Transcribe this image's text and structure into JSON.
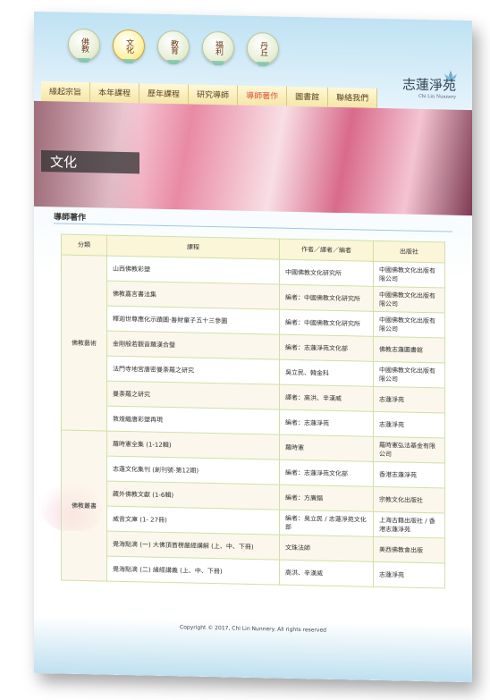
{
  "top_nav": [
    {
      "label": "佛教",
      "active": false
    },
    {
      "label": "文化",
      "active": true
    },
    {
      "label": "教育",
      "active": false
    },
    {
      "label": "福利",
      "active": false
    },
    {
      "label": "丹丘",
      "active": false
    }
  ],
  "logo": {
    "text": "志蓮淨苑",
    "subtext": "Chi Lin Nunnery"
  },
  "menu": [
    {
      "label": "緣起宗旨",
      "active": false
    },
    {
      "label": "本年課程",
      "active": false
    },
    {
      "label": "歷年課程",
      "active": false
    },
    {
      "label": "研究導師",
      "active": false
    },
    {
      "label": "導師著作",
      "active": true
    },
    {
      "label": "圖書館",
      "active": false
    },
    {
      "label": "聯絡我們",
      "active": false
    }
  ],
  "banner": {
    "title": "文化"
  },
  "section": {
    "title": "導師著作"
  },
  "table": {
    "headers": [
      "分類",
      "課程",
      "作者／譯者／編者",
      "出版社"
    ],
    "rows": [
      {
        "category": "佛教藝術",
        "span": 7,
        "title": "山西佛教彩塑",
        "author": "中國佛教文化研究所",
        "publisher": "中國佛教文化出版有限公司"
      },
      {
        "title": "佛教嘉言書法集",
        "author": "編者：中國佛教文化研究所",
        "publisher": "中國佛教文化出版有限公司"
      },
      {
        "title": "釋迦世尊應化示蹟圖·善財童子五十三參圖",
        "author": "編者：中國佛教文化研究所",
        "publisher": "中國佛教文化出版有限公司"
      },
      {
        "title": "金剛般若觀音羅漢合璧",
        "author": "編者：志蓮淨苑文化部",
        "publisher": "佛教志蓮圖書館"
      },
      {
        "title": "法門寺地宮唐密曼荼羅之研究",
        "author": "吳立民、韓金科",
        "publisher": "中國佛教文化出版有限公司"
      },
      {
        "title": "曼荼羅之研究",
        "author": "譯者：高洪、辛漢威",
        "publisher": "志蓮淨苑"
      },
      {
        "title": "敦煌繼唐彩塑再現",
        "author": "編者：志蓮淨苑",
        "publisher": "志蓮淨苑"
      },
      {
        "category": "佛教叢書",
        "span": 6,
        "title": "羅時憲全集 (1-12輯)",
        "author": "羅時憲",
        "publisher": "羅時憲弘法基金有限公司"
      },
      {
        "title": "志蓮文化集刊 (創刊號-第12期)",
        "author": "編者：志蓮淨苑文化部",
        "publisher": "香港志蓮淨苑"
      },
      {
        "title": "藏外佛教文獻 (1-6輯)",
        "author": "編者：方廣錩",
        "publisher": "宗教文化出版社"
      },
      {
        "title": "威音文庫 (1- 27冊)",
        "author": "編者：吳立民 / 志蓮淨苑文化部",
        "publisher": "上海古籍出版社 / 香港志蓮淨苑"
      },
      {
        "title": "覺海點滴 (一) 大佛頂首楞嚴經講解 (上、中、下冊)",
        "author": "文珠法師",
        "publisher": "美西佛教會出版"
      },
      {
        "title": "覺海點滴 (二) 諸經講義 (上、中、下冊)",
        "author": "高洪、辛漢威",
        "publisher": "志蓮淨苑"
      }
    ]
  },
  "footer": {
    "copyright": "Copyright © 2017, Chi Lin Nunnery. All rights reserved"
  }
}
